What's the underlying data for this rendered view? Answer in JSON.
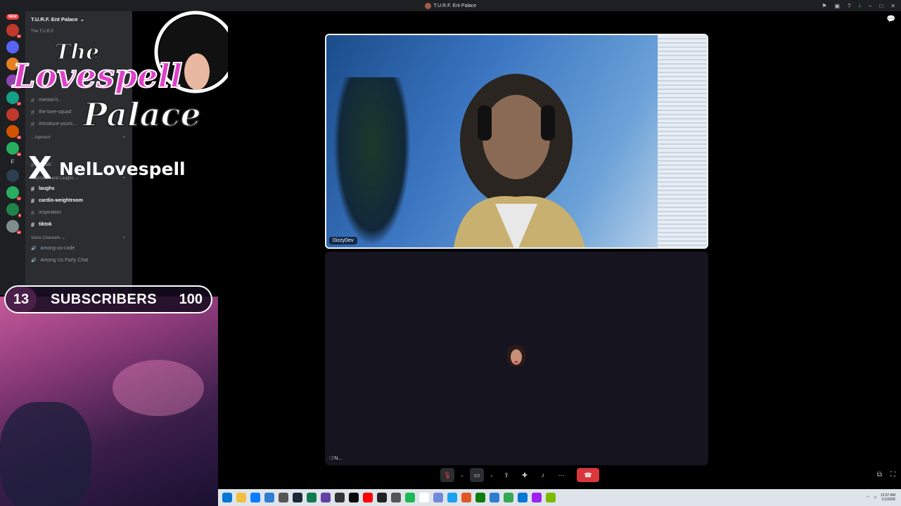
{
  "window": {
    "title": "T.U.R.F. Ent Palace",
    "titlebar_icons": [
      "flag-icon",
      "screen-icon",
      "help-icon",
      "download-icon",
      "minimize-icon",
      "maximize-icon",
      "close-icon"
    ]
  },
  "rail": {
    "new_badge": "NEW",
    "servers": [
      {
        "color": "#c0392b",
        "badge": "44"
      },
      {
        "color": "#5865f2",
        "badge": ""
      },
      {
        "color": "#e67e22",
        "badge": ""
      },
      {
        "color": "#8e44ad",
        "badge": "99+"
      },
      {
        "color": "#16a085",
        "badge": "17"
      },
      {
        "color": "#c0392b",
        "badge": ""
      },
      {
        "color": "#d35400",
        "badge": "35"
      },
      {
        "color": "#27ae60",
        "badge": "64"
      },
      {
        "color": "#2c3e50",
        "badge": ""
      },
      {
        "color": "#27ae60",
        "badge": "17"
      },
      {
        "color": "#1e8449",
        "badge": "8"
      },
      {
        "color": "#7f8c8d",
        "badge": "44"
      }
    ],
    "letter_server": "F"
  },
  "channels": {
    "server_name": "T.U.R.F. Ent Palace",
    "header_sub": "The T.U.R.F.",
    "top_items": [
      {
        "name": "mental-h…",
        "unread": false
      },
      {
        "name": "the-love-squad",
        "unread": false
      },
      {
        "name": "introduce-yours…",
        "unread": false
      }
    ],
    "category_1": "…lopment",
    "mid_items": [
      {
        "name": "music",
        "unread": false
      }
    ],
    "category_2": "Inspiration and Laughs",
    "inspiration_items": [
      {
        "name": "laughs",
        "unread": true
      },
      {
        "name": "cardio-weightroom",
        "unread": true
      },
      {
        "name": "inspiration",
        "unread": false
      },
      {
        "name": "tiktok",
        "unread": true
      }
    ],
    "category_3": "Voice Channels",
    "voice_items": [
      {
        "name": "among-us-code"
      },
      {
        "name": "Among Us Party Chat"
      }
    ]
  },
  "overlay": {
    "logo_line1": "The",
    "logo_line2": "Lovespell",
    "logo_line3": "Palace",
    "x_mark": "X",
    "handle": "NelLovespell",
    "subs_count": "13",
    "subs_label": "SUBSCRIBERS",
    "subs_goal": "100"
  },
  "call": {
    "participant_1": "DizzyDev",
    "participant_2": "N...",
    "controls": [
      "mic-muted-icon",
      "chevron-down-icon",
      "camera-off-icon",
      "chevron-down-icon",
      "screen-share-icon",
      "activities-icon",
      "soundboard-icon",
      "more-icon"
    ],
    "leave_icon": "hangup-icon",
    "accent_leave": "#da373c"
  },
  "taskbar": {
    "clock_time": "12:07 AM",
    "clock_date": "1/1/2026",
    "app_colors": [
      "#0078d4",
      "#f0c040",
      "#0a7cff",
      "#2d7dd2",
      "#555",
      "#1b2838",
      "#0f7b4f",
      "#6441a5",
      "#333",
      "#0a0a0a",
      "#ff0000",
      "#222",
      "#555",
      "#1db954",
      "#ffffff",
      "#7289da",
      "#1da1f2",
      "#e25822",
      "#107c10",
      "#2d7dd2",
      "#34a853",
      "#0078d4",
      "#a020f0",
      "#7fba00"
    ]
  }
}
